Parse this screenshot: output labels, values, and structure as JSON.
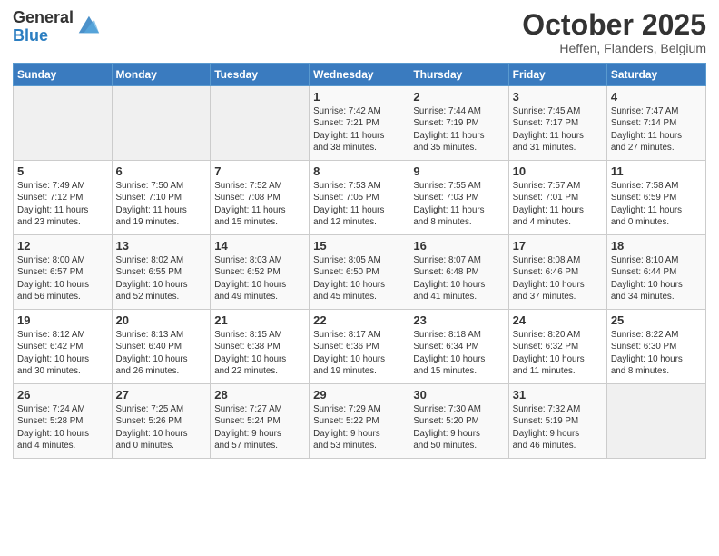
{
  "header": {
    "logo_general": "General",
    "logo_blue": "Blue",
    "month_title": "October 2025",
    "location": "Heffen, Flanders, Belgium"
  },
  "days_of_week": [
    "Sunday",
    "Monday",
    "Tuesday",
    "Wednesday",
    "Thursday",
    "Friday",
    "Saturday"
  ],
  "weeks": [
    [
      {
        "day": "",
        "info": ""
      },
      {
        "day": "",
        "info": ""
      },
      {
        "day": "",
        "info": ""
      },
      {
        "day": "1",
        "info": "Sunrise: 7:42 AM\nSunset: 7:21 PM\nDaylight: 11 hours\nand 38 minutes."
      },
      {
        "day": "2",
        "info": "Sunrise: 7:44 AM\nSunset: 7:19 PM\nDaylight: 11 hours\nand 35 minutes."
      },
      {
        "day": "3",
        "info": "Sunrise: 7:45 AM\nSunset: 7:17 PM\nDaylight: 11 hours\nand 31 minutes."
      },
      {
        "day": "4",
        "info": "Sunrise: 7:47 AM\nSunset: 7:14 PM\nDaylight: 11 hours\nand 27 minutes."
      }
    ],
    [
      {
        "day": "5",
        "info": "Sunrise: 7:49 AM\nSunset: 7:12 PM\nDaylight: 11 hours\nand 23 minutes."
      },
      {
        "day": "6",
        "info": "Sunrise: 7:50 AM\nSunset: 7:10 PM\nDaylight: 11 hours\nand 19 minutes."
      },
      {
        "day": "7",
        "info": "Sunrise: 7:52 AM\nSunset: 7:08 PM\nDaylight: 11 hours\nand 15 minutes."
      },
      {
        "day": "8",
        "info": "Sunrise: 7:53 AM\nSunset: 7:05 PM\nDaylight: 11 hours\nand 12 minutes."
      },
      {
        "day": "9",
        "info": "Sunrise: 7:55 AM\nSunset: 7:03 PM\nDaylight: 11 hours\nand 8 minutes."
      },
      {
        "day": "10",
        "info": "Sunrise: 7:57 AM\nSunset: 7:01 PM\nDaylight: 11 hours\nand 4 minutes."
      },
      {
        "day": "11",
        "info": "Sunrise: 7:58 AM\nSunset: 6:59 PM\nDaylight: 11 hours\nand 0 minutes."
      }
    ],
    [
      {
        "day": "12",
        "info": "Sunrise: 8:00 AM\nSunset: 6:57 PM\nDaylight: 10 hours\nand 56 minutes."
      },
      {
        "day": "13",
        "info": "Sunrise: 8:02 AM\nSunset: 6:55 PM\nDaylight: 10 hours\nand 52 minutes."
      },
      {
        "day": "14",
        "info": "Sunrise: 8:03 AM\nSunset: 6:52 PM\nDaylight: 10 hours\nand 49 minutes."
      },
      {
        "day": "15",
        "info": "Sunrise: 8:05 AM\nSunset: 6:50 PM\nDaylight: 10 hours\nand 45 minutes."
      },
      {
        "day": "16",
        "info": "Sunrise: 8:07 AM\nSunset: 6:48 PM\nDaylight: 10 hours\nand 41 minutes."
      },
      {
        "day": "17",
        "info": "Sunrise: 8:08 AM\nSunset: 6:46 PM\nDaylight: 10 hours\nand 37 minutes."
      },
      {
        "day": "18",
        "info": "Sunrise: 8:10 AM\nSunset: 6:44 PM\nDaylight: 10 hours\nand 34 minutes."
      }
    ],
    [
      {
        "day": "19",
        "info": "Sunrise: 8:12 AM\nSunset: 6:42 PM\nDaylight: 10 hours\nand 30 minutes."
      },
      {
        "day": "20",
        "info": "Sunrise: 8:13 AM\nSunset: 6:40 PM\nDaylight: 10 hours\nand 26 minutes."
      },
      {
        "day": "21",
        "info": "Sunrise: 8:15 AM\nSunset: 6:38 PM\nDaylight: 10 hours\nand 22 minutes."
      },
      {
        "day": "22",
        "info": "Sunrise: 8:17 AM\nSunset: 6:36 PM\nDaylight: 10 hours\nand 19 minutes."
      },
      {
        "day": "23",
        "info": "Sunrise: 8:18 AM\nSunset: 6:34 PM\nDaylight: 10 hours\nand 15 minutes."
      },
      {
        "day": "24",
        "info": "Sunrise: 8:20 AM\nSunset: 6:32 PM\nDaylight: 10 hours\nand 11 minutes."
      },
      {
        "day": "25",
        "info": "Sunrise: 8:22 AM\nSunset: 6:30 PM\nDaylight: 10 hours\nand 8 minutes."
      }
    ],
    [
      {
        "day": "26",
        "info": "Sunrise: 7:24 AM\nSunset: 5:28 PM\nDaylight: 10 hours\nand 4 minutes."
      },
      {
        "day": "27",
        "info": "Sunrise: 7:25 AM\nSunset: 5:26 PM\nDaylight: 10 hours\nand 0 minutes."
      },
      {
        "day": "28",
        "info": "Sunrise: 7:27 AM\nSunset: 5:24 PM\nDaylight: 9 hours\nand 57 minutes."
      },
      {
        "day": "29",
        "info": "Sunrise: 7:29 AM\nSunset: 5:22 PM\nDaylight: 9 hours\nand 53 minutes."
      },
      {
        "day": "30",
        "info": "Sunrise: 7:30 AM\nSunset: 5:20 PM\nDaylight: 9 hours\nand 50 minutes."
      },
      {
        "day": "31",
        "info": "Sunrise: 7:32 AM\nSunset: 5:19 PM\nDaylight: 9 hours\nand 46 minutes."
      },
      {
        "day": "",
        "info": ""
      }
    ]
  ]
}
